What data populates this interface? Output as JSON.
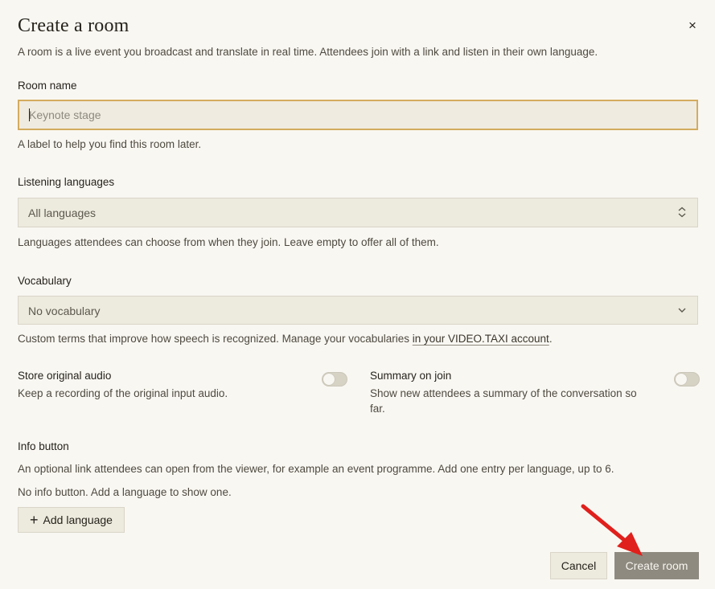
{
  "dialog": {
    "title": "Create a room",
    "subtitle": "A room is a live event you broadcast and translate in real time. Attendees join with a link and listen in their own language.",
    "close_icon": "×"
  },
  "room_name": {
    "label": "Room name",
    "placeholder": "Keynote stage",
    "help": "A label to help you find this room later."
  },
  "listening_languages": {
    "label": "Listening languages",
    "value": "All languages",
    "help": "Languages attendees can choose from when they join. Leave empty to offer all of them."
  },
  "vocabulary": {
    "label": "Vocabulary",
    "value": "No vocabulary",
    "help_prefix": "Custom terms that improve how speech is recognized. Manage your vocabularies ",
    "help_link": "in your VIDEO.TAXI account",
    "help_suffix": "."
  },
  "store_audio": {
    "label": "Store original audio",
    "description": "Keep a recording of the original input audio.",
    "enabled": false
  },
  "summary_on_join": {
    "label": "Summary on join",
    "description_line1": "Show new attendees a summary of the conversation so",
    "description_line2": "far.",
    "enabled": false
  },
  "info_button": {
    "label": "Info button",
    "description": "An optional link attendees can open from the viewer, for example an event programme. Add one entry per language, up to 6.",
    "empty_text": "No info button. Add a language to show one.",
    "add_label": "Add language",
    "add_icon": "+"
  },
  "footer": {
    "cancel_label": "Cancel",
    "create_label": "Create room"
  },
  "colors": {
    "background": "#f9f7f2",
    "field_background": "#edeade",
    "focus_border": "#d3ab5e",
    "primary_button": "#8e8a80",
    "annotation_arrow": "#e0201c"
  }
}
